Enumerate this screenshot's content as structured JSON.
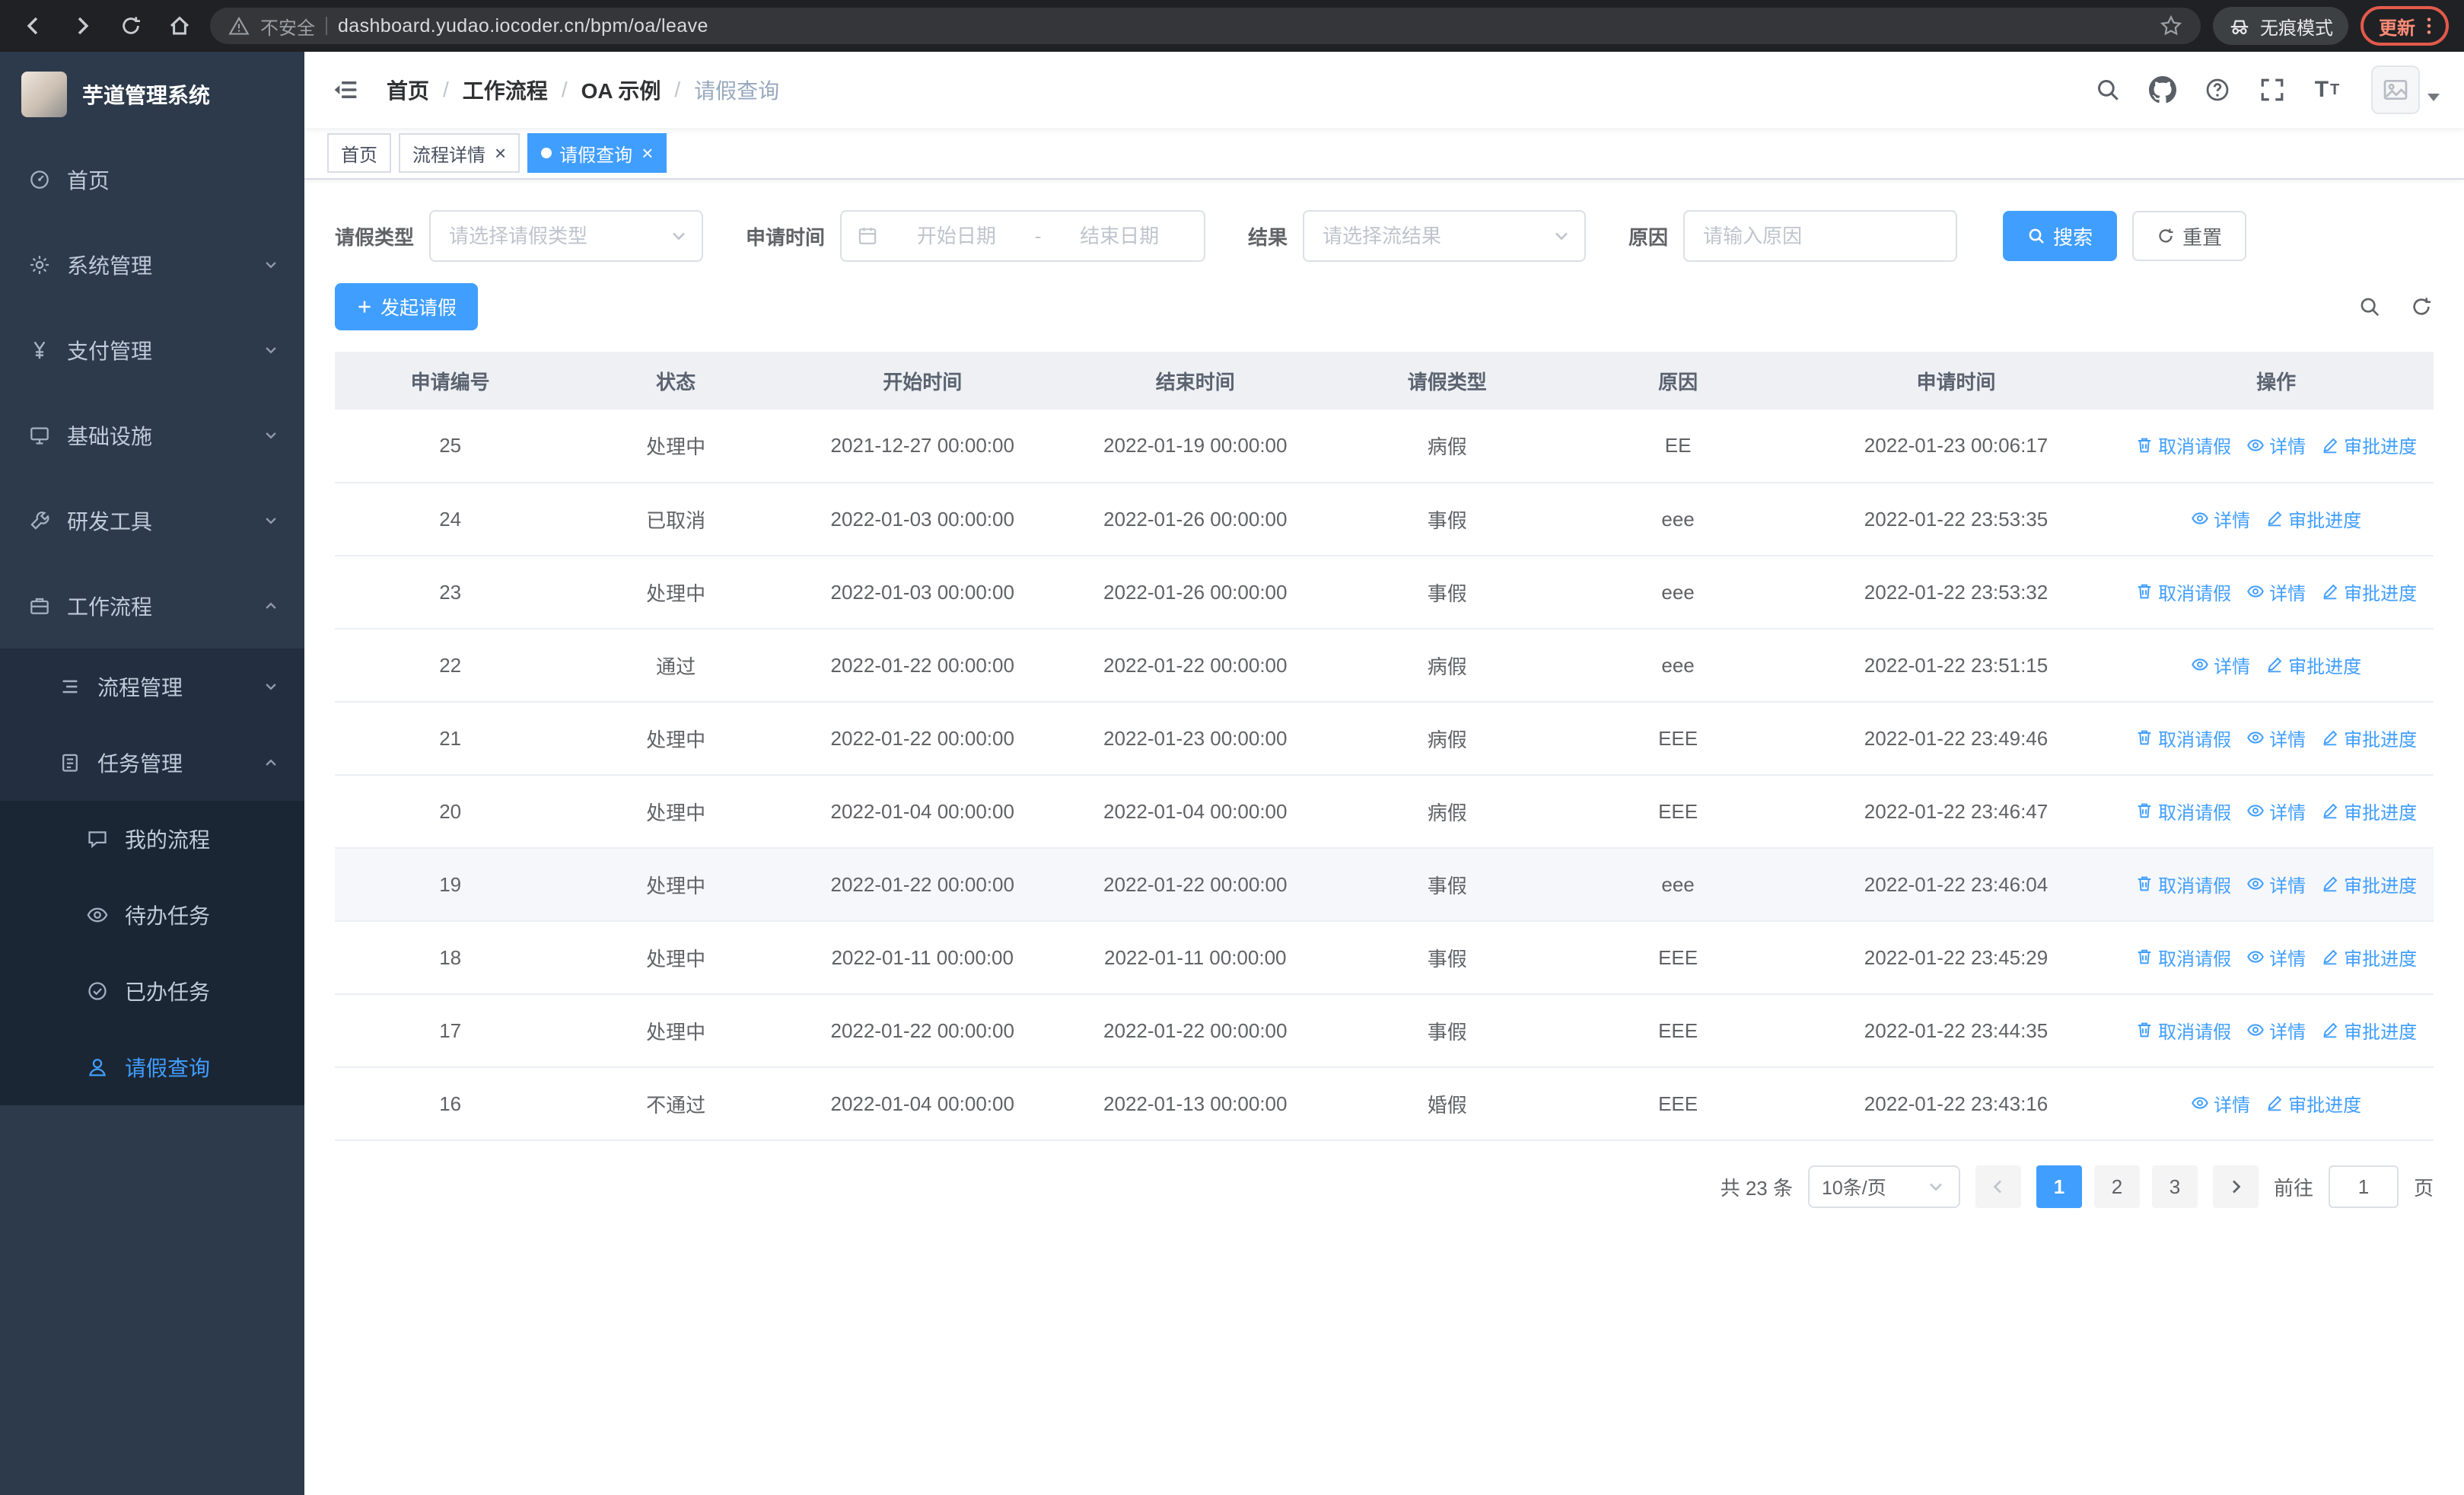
{
  "browser": {
    "security_label": "不安全",
    "url": "dashboard.yudao.iocoder.cn/bpm/oa/leave",
    "incognito_label": "无痕模式",
    "update_label": "更新"
  },
  "sidebar": {
    "logo_title": "芋道管理系统",
    "items": [
      {
        "label": "首页"
      },
      {
        "label": "系统管理"
      },
      {
        "label": "支付管理"
      },
      {
        "label": "基础设施"
      },
      {
        "label": "研发工具"
      },
      {
        "label": "工作流程"
      },
      {
        "label": "流程管理"
      },
      {
        "label": "任务管理"
      },
      {
        "label": "我的流程"
      },
      {
        "label": "待办任务"
      },
      {
        "label": "已办任务"
      },
      {
        "label": "请假查询"
      }
    ]
  },
  "header": {
    "breadcrumb": [
      "首页",
      "工作流程",
      "OA 示例",
      "请假查询"
    ]
  },
  "tabs": [
    {
      "label": "首页",
      "closable": false,
      "active": false
    },
    {
      "label": "流程详情",
      "closable": true,
      "active": false
    },
    {
      "label": "请假查询",
      "closable": true,
      "active": true
    }
  ],
  "filters": {
    "leave_type_label": "请假类型",
    "leave_type_placeholder": "请选择请假类型",
    "apply_time_label": "申请时间",
    "start_date_placeholder": "开始日期",
    "range_separator": "-",
    "end_date_placeholder": "结束日期",
    "result_label": "结果",
    "result_placeholder": "请选择流结果",
    "reason_label": "原因",
    "reason_placeholder": "请输入原因",
    "search_label": "搜索",
    "reset_label": "重置"
  },
  "toolbar": {
    "create_label": "发起请假"
  },
  "table": {
    "columns": [
      "申请编号",
      "状态",
      "开始时间",
      "结束时间",
      "请假类型",
      "原因",
      "申请时间",
      "操作"
    ],
    "rows": [
      {
        "id": "25",
        "status": "处理中",
        "start_time": "2021-12-27 00:00:00",
        "end_time": "2022-01-19 00:00:00",
        "leave_type": "病假",
        "reason": "EE",
        "apply_time": "2022-01-23 00:06:17",
        "highlighted": false,
        "actions": [
          {
            "key": "cancel",
            "icon": "delete",
            "label": "取消请假"
          },
          {
            "key": "detail",
            "icon": "view",
            "label": "详情"
          },
          {
            "key": "progress",
            "icon": "edit",
            "label": "审批进度"
          }
        ]
      },
      {
        "id": "24",
        "status": "已取消",
        "start_time": "2022-01-03 00:00:00",
        "end_time": "2022-01-26 00:00:00",
        "leave_type": "事假",
        "reason": "eee",
        "apply_time": "2022-01-22 23:53:35",
        "highlighted": false,
        "actions": [
          {
            "key": "detail",
            "icon": "view",
            "label": "详情"
          },
          {
            "key": "progress",
            "icon": "edit",
            "label": "审批进度"
          }
        ]
      },
      {
        "id": "23",
        "status": "处理中",
        "start_time": "2022-01-03 00:00:00",
        "end_time": "2022-01-26 00:00:00",
        "leave_type": "事假",
        "reason": "eee",
        "apply_time": "2022-01-22 23:53:32",
        "highlighted": false,
        "actions": [
          {
            "key": "cancel",
            "icon": "delete",
            "label": "取消请假"
          },
          {
            "key": "detail",
            "icon": "view",
            "label": "详情"
          },
          {
            "key": "progress",
            "icon": "edit",
            "label": "审批进度"
          }
        ]
      },
      {
        "id": "22",
        "status": "通过",
        "start_time": "2022-01-22 00:00:00",
        "end_time": "2022-01-22 00:00:00",
        "leave_type": "病假",
        "reason": "eee",
        "apply_time": "2022-01-22 23:51:15",
        "highlighted": false,
        "actions": [
          {
            "key": "detail",
            "icon": "view",
            "label": "详情"
          },
          {
            "key": "progress",
            "icon": "edit",
            "label": "审批进度"
          }
        ]
      },
      {
        "id": "21",
        "status": "处理中",
        "start_time": "2022-01-22 00:00:00",
        "end_time": "2022-01-23 00:00:00",
        "leave_type": "病假",
        "reason": "EEE",
        "apply_time": "2022-01-22 23:49:46",
        "highlighted": false,
        "actions": [
          {
            "key": "cancel",
            "icon": "delete",
            "label": "取消请假"
          },
          {
            "key": "detail",
            "icon": "view",
            "label": "详情"
          },
          {
            "key": "progress",
            "icon": "edit",
            "label": "审批进度"
          }
        ]
      },
      {
        "id": "20",
        "status": "处理中",
        "start_time": "2022-01-04 00:00:00",
        "end_time": "2022-01-04 00:00:00",
        "leave_type": "病假",
        "reason": "EEE",
        "apply_time": "2022-01-22 23:46:47",
        "highlighted": false,
        "actions": [
          {
            "key": "cancel",
            "icon": "delete",
            "label": "取消请假"
          },
          {
            "key": "detail",
            "icon": "view",
            "label": "详情"
          },
          {
            "key": "progress",
            "icon": "edit",
            "label": "审批进度"
          }
        ]
      },
      {
        "id": "19",
        "status": "处理中",
        "start_time": "2022-01-22 00:00:00",
        "end_time": "2022-01-22 00:00:00",
        "leave_type": "事假",
        "reason": "eee",
        "apply_time": "2022-01-22 23:46:04",
        "highlighted": true,
        "actions": [
          {
            "key": "cancel",
            "icon": "delete",
            "label": "取消请假"
          },
          {
            "key": "detail",
            "icon": "view",
            "label": "详情"
          },
          {
            "key": "progress",
            "icon": "edit",
            "label": "审批进度"
          }
        ]
      },
      {
        "id": "18",
        "status": "处理中",
        "start_time": "2022-01-11 00:00:00",
        "end_time": "2022-01-11 00:00:00",
        "leave_type": "事假",
        "reason": "EEE",
        "apply_time": "2022-01-22 23:45:29",
        "highlighted": false,
        "actions": [
          {
            "key": "cancel",
            "icon": "delete",
            "label": "取消请假"
          },
          {
            "key": "detail",
            "icon": "view",
            "label": "详情"
          },
          {
            "key": "progress",
            "icon": "edit",
            "label": "审批进度"
          }
        ]
      },
      {
        "id": "17",
        "status": "处理中",
        "start_time": "2022-01-22 00:00:00",
        "end_time": "2022-01-22 00:00:00",
        "leave_type": "事假",
        "reason": "EEE",
        "apply_time": "2022-01-22 23:44:35",
        "highlighted": false,
        "actions": [
          {
            "key": "cancel",
            "icon": "delete",
            "label": "取消请假"
          },
          {
            "key": "detail",
            "icon": "view",
            "label": "详情"
          },
          {
            "key": "progress",
            "icon": "edit",
            "label": "审批进度"
          }
        ]
      },
      {
        "id": "16",
        "status": "不通过",
        "start_time": "2022-01-04 00:00:00",
        "end_time": "2022-01-13 00:00:00",
        "leave_type": "婚假",
        "reason": "EEE",
        "apply_time": "2022-01-22 23:43:16",
        "highlighted": false,
        "actions": [
          {
            "key": "detail",
            "icon": "view",
            "label": "详情"
          },
          {
            "key": "progress",
            "icon": "edit",
            "label": "审批进度"
          }
        ]
      }
    ]
  },
  "pagination": {
    "total_label": "共 23 条",
    "page_size_label": "10条/页",
    "pages": [
      "1",
      "2",
      "3"
    ],
    "active_page": "1",
    "goto_label": "前往",
    "goto_value": "1",
    "page_unit_label": "页"
  },
  "colors": {
    "primary": "#409eff",
    "sidebar_bg": "#2d3a4b",
    "update_chip": "#e25a4b"
  }
}
